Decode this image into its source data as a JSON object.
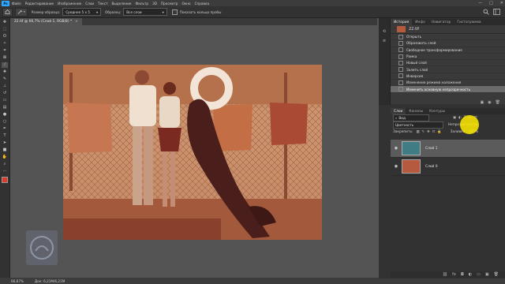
{
  "menubar": {
    "logo": "Ps",
    "items": [
      "Файл",
      "Редактирование",
      "Изображение",
      "Слои",
      "Текст",
      "Выделение",
      "Фильтр",
      "3D",
      "Просмотр",
      "Окно",
      "Справка"
    ],
    "controls": [
      "—",
      "□",
      "✕"
    ]
  },
  "options": {
    "sample_size_label": "Размер образца:",
    "sample_size_value": "Среднее 5 х 5",
    "sample_label": "Образец:",
    "sample_value": "Все слои",
    "show_ring_label": "Показать кольцо пробы"
  },
  "document": {
    "tab_title": "22.tif @ 66,7% (Слой 1, RGB/8) *",
    "close": "×"
  },
  "history": {
    "tabs": [
      "История",
      "Инфо",
      "Навигатор",
      "Гистограмма"
    ],
    "snapshot": "22.tif",
    "items": [
      "Открыть",
      "Образовать слой",
      "Свободное трансформирование",
      "Рамка",
      "Новый слой",
      "Залить слой",
      "Инверсия",
      "Изменение режима наложения",
      "Изменить основную непрозрачность"
    ],
    "selected_index": 8
  },
  "layers": {
    "tabs": [
      "Слои",
      "Каналы",
      "Контуры"
    ],
    "filter": "Вид",
    "blend_mode": "Цветность",
    "opacity_label": "Непрозрачность:",
    "lock_label": "Закрепить:",
    "fill_label": "Заливка:",
    "fill_value": "100%",
    "items": [
      {
        "name": "Слой 1",
        "selected": true,
        "color": "#3f7c84"
      },
      {
        "name": "Слой 0",
        "selected": false,
        "color": "#b55a3f"
      }
    ]
  },
  "status": {
    "zoom": "66,67%",
    "doc": "Док: 6,21M/6,21M"
  },
  "toolbar": {
    "icons": [
      "move-icon",
      "marquee-icon",
      "lasso-icon",
      "magic-wand-icon",
      "crop-icon",
      "frame-icon",
      "eyedropper-icon",
      "healing-icon",
      "brush-icon",
      "clone-stamp-icon",
      "history-brush-icon",
      "eraser-icon",
      "gradient-icon",
      "blur-icon",
      "dodge-icon",
      "pen-icon",
      "type-icon",
      "path-selection-icon",
      "shape-icon",
      "hand-icon",
      "zoom-icon",
      "more-icon"
    ]
  }
}
